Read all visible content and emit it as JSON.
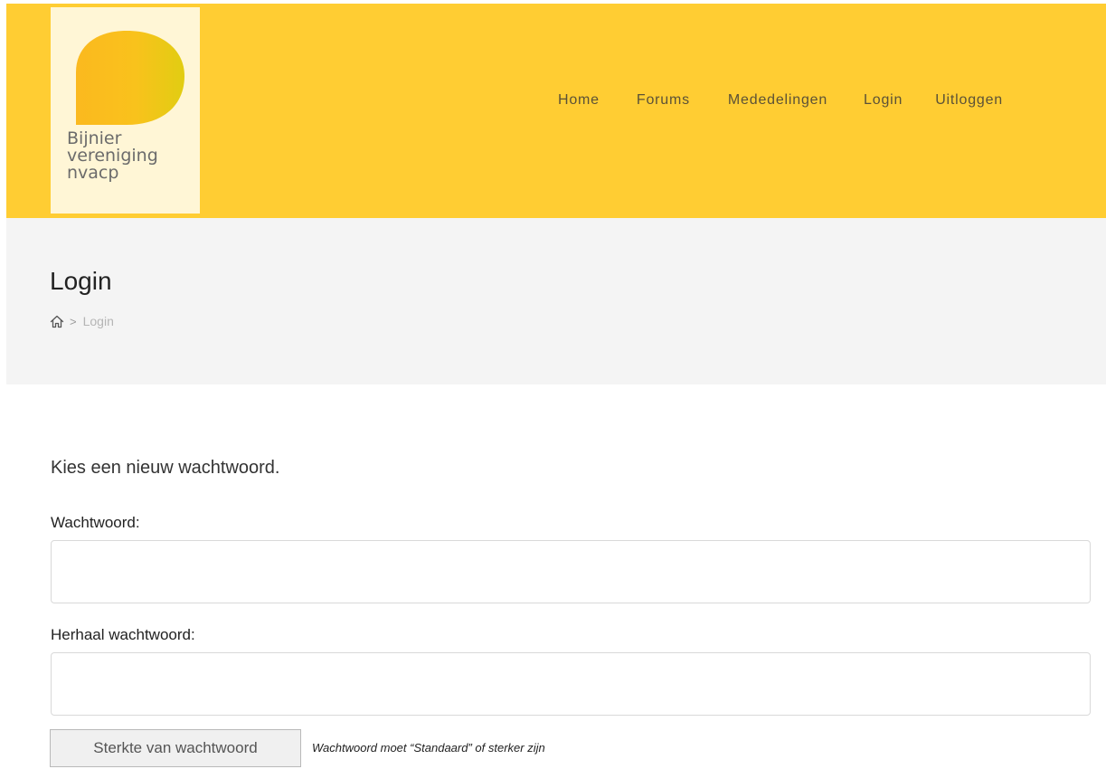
{
  "logo": {
    "line1": "Bijnier",
    "line2": "vereniging",
    "line3": "nvacp"
  },
  "nav": {
    "items": [
      "Home",
      "Forums",
      "Mededelingen",
      "Login",
      "Uitloggen"
    ]
  },
  "banner": {
    "title": "Login",
    "breadcrumb_separator": ">",
    "breadcrumb_current": "Login"
  },
  "form": {
    "intro": "Kies een nieuw wachtwoord.",
    "password_label": "Wachtwoord:",
    "password_value": "",
    "repeat_label": "Herhaal wachtwoord:",
    "repeat_value": "",
    "strength_label": "Sterkte van wachtwoord",
    "hint": "Wachtwoord moet “Standaard” of sterker zijn"
  },
  "colors": {
    "header_bg": "#ffcd33",
    "logo_bg": "#fff6d6",
    "banner_bg": "#f4f4f4"
  },
  "icons": {
    "breadcrumb_home": "home-icon",
    "logo_mark": "leaf-icon"
  }
}
